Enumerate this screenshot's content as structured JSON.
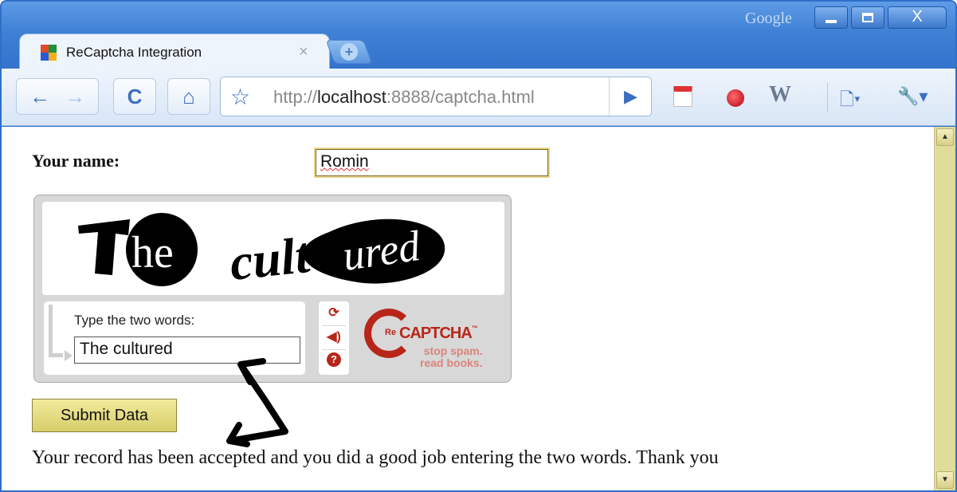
{
  "window": {
    "brand": "Google",
    "close_glyph": "X"
  },
  "tab": {
    "title": "ReCaptcha Integration",
    "close_glyph": "×",
    "newtab_glyph": "+"
  },
  "toolbar": {
    "back_icon": "←",
    "forward_icon": "→",
    "reload_icon": "C",
    "home_icon": "⌂",
    "star_icon": "☆",
    "url_scheme": "http://",
    "url_host": "localhost",
    "url_rest": ":8888/captcha.html",
    "go_icon": "▶",
    "extensions": [
      "calendar-icon",
      "record-icon",
      "wl-icon"
    ],
    "page_menu_icon": "🗋▾",
    "wrench_menu_icon": "🔧▾"
  },
  "form": {
    "name_label": "Your name:",
    "name_value": "Romin",
    "submit_label": "Submit Data"
  },
  "recaptcha": {
    "words": [
      "The",
      "cultured"
    ],
    "prompt": "Type the two words:",
    "response_value": "The cultured",
    "brand_prefix": "Re",
    "brand_name": "CAPTCHA",
    "trademark": "™",
    "tagline_1": "stop spam.",
    "tagline_2": "read books.",
    "reload_icon": "⟳",
    "audio_icon": "◀)",
    "help_icon": "?"
  },
  "message": {
    "result_text": "Your record has been accepted and you did a good job entering the two words. Thank you"
  },
  "scrollbar": {
    "up_glyph": "▲",
    "down_glyph": "▼"
  }
}
